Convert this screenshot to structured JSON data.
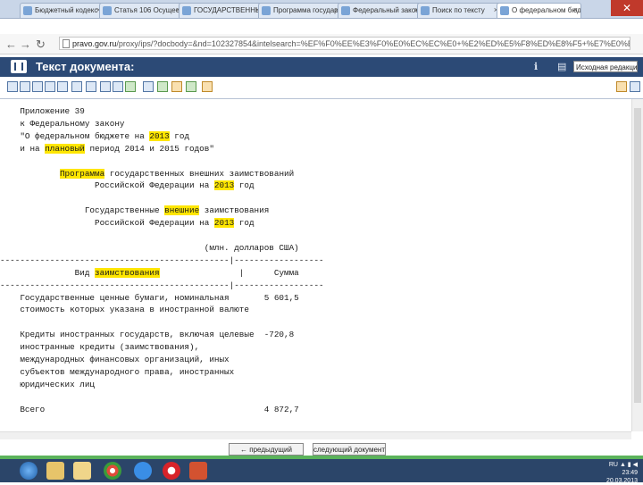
{
  "browser": {
    "tabs": [
      {
        "label": "Бюджетный кодекс",
        "active": false
      },
      {
        "label": "Статья 106 Осуществ",
        "active": false
      },
      {
        "label": "ГОСУДАРСТВЕННЫЕ",
        "active": false
      },
      {
        "label": "Программа государств",
        "active": false
      },
      {
        "label": "Федеральный закон",
        "active": false
      },
      {
        "label": "Поиск по тексту",
        "active": false
      },
      {
        "label": "О федеральном бюд",
        "active": true
      }
    ],
    "url_host": "pravo.gov.ru",
    "url_rest": "/proxy/ips/?docbody=&nd=102327854&intelsearch=%EF%F0%EE%E3%F0%E0%EC%EC%E0+%E2%ED%E5%F8%ED%E8%F5+%E7%E0%E8%EC%F1%F2%E2%EE%E2%E0"
  },
  "doc_header": {
    "title": "Текст документа:",
    "edition": "Исходная редакция"
  },
  "document": {
    "lines": [
      {
        "segments": [
          "    Приложение 39"
        ]
      },
      {
        "segments": [
          "    к Федеральному закону"
        ]
      },
      {
        "segments": [
          "    \"О федеральном бюджете на ",
          {
            "hl": "2013"
          },
          " год"
        ]
      },
      {
        "segments": [
          "    и на ",
          {
            "hl": "плановый"
          },
          " период 2014 и 2015 годов\""
        ]
      },
      {
        "segments": [
          ""
        ]
      },
      {
        "segments": [
          "            ",
          {
            "hl": "Программа"
          },
          " государственных внешних заимствований"
        ]
      },
      {
        "segments": [
          "                   Российской Федерации на ",
          {
            "hl": "2013"
          },
          " год"
        ]
      },
      {
        "segments": [
          ""
        ]
      },
      {
        "segments": [
          "                 Государственные ",
          {
            "hl": "внешние"
          },
          " заимствования"
        ]
      },
      {
        "segments": [
          "                   Российской Федерации на ",
          {
            "hl": "2013"
          },
          " год"
        ]
      },
      {
        "segments": [
          ""
        ]
      },
      {
        "segments": [
          "                                         (млн. долларов США)"
        ]
      },
      {
        "segments": [
          "----------------------------------------------|------------------"
        ]
      },
      {
        "segments": [
          "               Вид ",
          {
            "hl": "заимствования"
          },
          "                |      Сумма"
        ]
      },
      {
        "segments": [
          "----------------------------------------------|------------------"
        ]
      },
      {
        "segments": [
          "    Государственные ценные бумаги, номинальная       5 601,5"
        ]
      },
      {
        "segments": [
          "    стоимость которых указана в иностранной валюте"
        ]
      },
      {
        "segments": [
          ""
        ]
      },
      {
        "segments": [
          "    Кредиты иностранных государств, включая целевые  -720,8"
        ]
      },
      {
        "segments": [
          "    иностранные кредиты (заимствования),"
        ]
      },
      {
        "segments": [
          "    международных финансовых организаций, иных"
        ]
      },
      {
        "segments": [
          "    субъектов международного права, иностранных"
        ]
      },
      {
        "segments": [
          "    юридических лиц"
        ]
      },
      {
        "segments": [
          ""
        ]
      },
      {
        "segments": [
          "    Всего                                            4 872,7"
        ]
      }
    ]
  },
  "footer": {
    "prev_label": "← предыдущий документ",
    "next_label": "следующий документ →"
  },
  "taskbar": {
    "lang": "RU",
    "time": "23:49",
    "date": "20.03.2013"
  }
}
